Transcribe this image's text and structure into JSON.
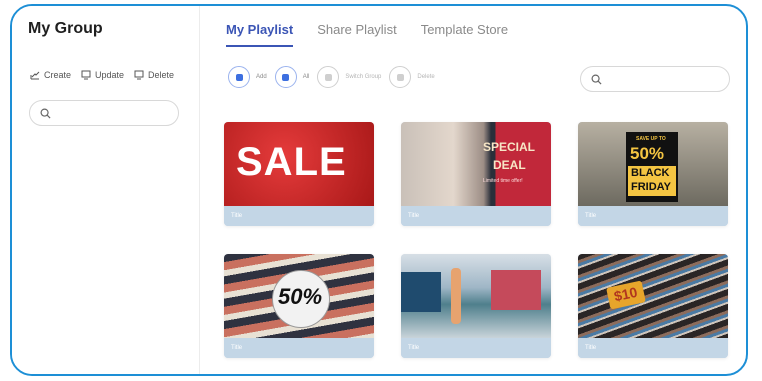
{
  "sidebar": {
    "title": "My Group",
    "actions": [
      {
        "label": "Create",
        "icon": "create-icon"
      },
      {
        "label": "Update",
        "icon": "monitor-icon"
      },
      {
        "label": "Delete",
        "icon": "monitor-icon"
      }
    ],
    "search": {
      "placeholder": "",
      "icon": "search-icon"
    }
  },
  "tabs": [
    {
      "label": "My Playlist",
      "active": true
    },
    {
      "label": "Share Playlist",
      "active": false
    },
    {
      "label": "Template Store",
      "active": false
    }
  ],
  "toolbar": {
    "items": [
      {
        "label": "Add",
        "active": true,
        "icon": "add-icon"
      },
      {
        "label": "All",
        "active": true,
        "icon": "select-all-icon"
      },
      {
        "label": "Switch Group",
        "active": false,
        "icon": "switch-group-icon"
      },
      {
        "label": "Delete",
        "active": false,
        "icon": "trash-icon"
      }
    ]
  },
  "search": {
    "placeholder": "",
    "icon": "search-icon"
  },
  "cards": [
    {
      "title": "Title",
      "thumb_text": [
        "SALE"
      ]
    },
    {
      "title": "Title",
      "thumb_text": [
        "SPECIAL",
        "DEAL",
        "Limited time offer!"
      ]
    },
    {
      "title": "Title",
      "thumb_text": [
        "SAVE UP TO",
        "50%",
        "BLACK",
        "FRIDAY"
      ]
    },
    {
      "title": "Title",
      "thumb_text": [
        "50%"
      ]
    },
    {
      "title": "Title",
      "thumb_text": []
    },
    {
      "title": "Title",
      "thumb_text": [
        "$10"
      ]
    }
  ],
  "colors": {
    "accent": "#3b55b5",
    "frame": "#1d8fd6",
    "caption": "#c3d6e6"
  }
}
